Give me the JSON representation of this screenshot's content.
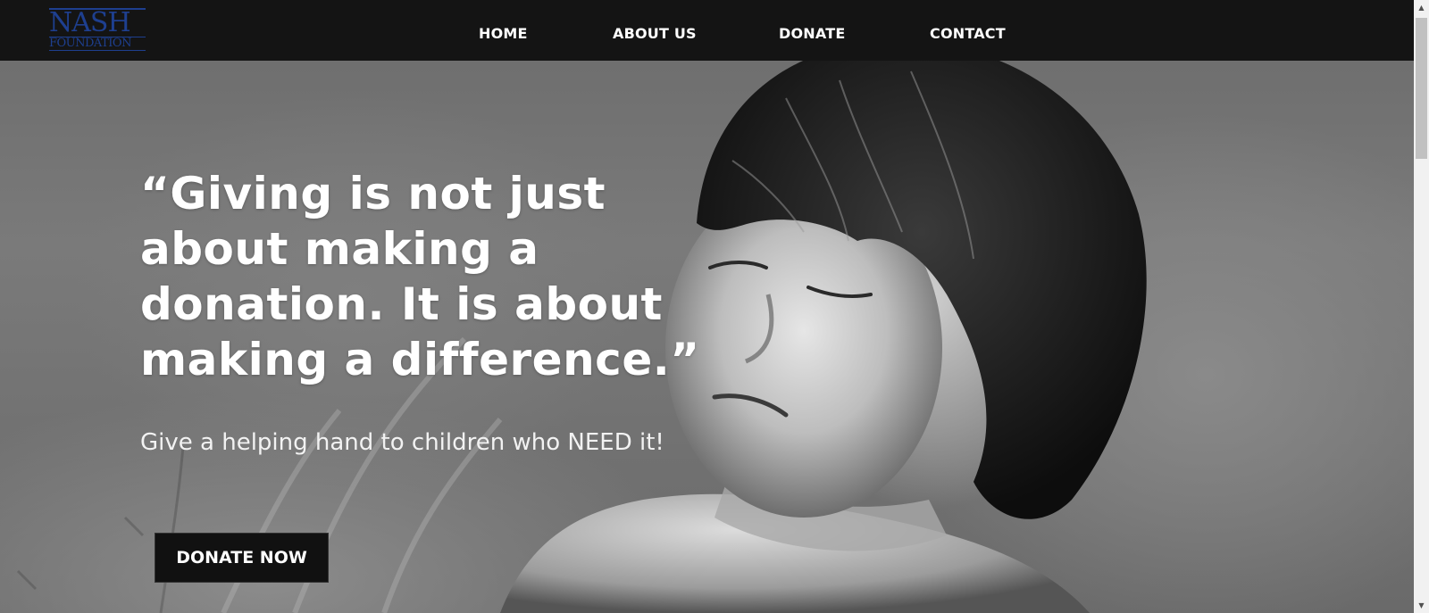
{
  "nav": {
    "logo_main": "NASH",
    "logo_sub": "FOUNDATION",
    "items": [
      {
        "label": "HOME"
      },
      {
        "label": "ABOUT US"
      },
      {
        "label": "DONATE"
      },
      {
        "label": "CONTACT"
      }
    ]
  },
  "hero": {
    "quote": "“Giving is not just about making a donation. It is about making a difference.”",
    "subtitle": "Give a helping hand to children who NEED it!",
    "cta_label": "DONATE NOW"
  },
  "scrollbar": {
    "up_icon": "▲",
    "down_icon": "▼"
  },
  "colors": {
    "topbar": "#141414",
    "logo": "#1e3f8f",
    "text": "#ffffff",
    "button": "#111111"
  }
}
